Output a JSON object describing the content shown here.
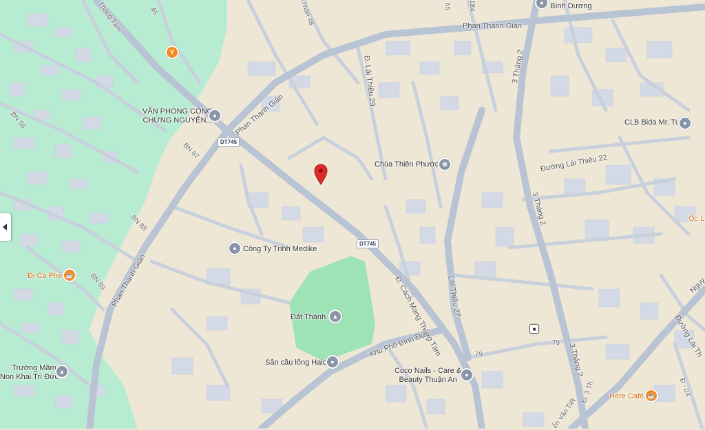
{
  "map": {
    "land_color": "#efe7d6",
    "park_color": "#b8ecd2",
    "road_color": "#b8c3d4",
    "block_color": "#d3dae6",
    "pin_color": "#e02a2a"
  },
  "roads": {
    "phan_thanh_gian_top": "Phan Thanh Gián",
    "phan_thanh_gian_mid": "Phan Thanh Gián",
    "phan_thanh_gian_left": "Phan Thanh Gián",
    "lai_thieu_29": "Đ. Lái Thiêu 29",
    "cmt8": "Đ. Cách Mạng Tháng Tám",
    "three_thang_2_a": "3 Tháng 2",
    "three_thang_2_b": "3 Tháng 2",
    "three_thang_2_c": "3 Tháng 2",
    "lai_thieu_22": "Đường Lái Thiêu 22",
    "lai_thieu_27": "Lái Thiêu 27",
    "khu_pho_binh_duc": "Khu Phố Bình Đức",
    "bn88": "BN 88",
    "bn88b": "BN 88",
    "bn87": "BN 87",
    "bn89": "BN 89",
    "thang_tam": "Tháng Tám",
    "than_48": "Thân 48",
    "n46": "46",
    "n184": "184",
    "n65": "65",
    "n79a": "79",
    "n79b": "79",
    "d04": "Đ - 04",
    "dl3": "Đ. 3 Th",
    "van_viet": "ễn Văn Tiết",
    "lai_thieu_right": "Đường Lái Th",
    "nguy": "Nguy"
  },
  "route_badges": [
    "DT745",
    "DT745"
  ],
  "places": {
    "binh_duong": "Bình Dương",
    "van_phong_line1": "VĂN PHÒNG CÔNG",
    "van_phong_line2": "CHỨNG NGUYỄN...",
    "clb_bida": "CLB Bida Mr. Tui",
    "chua_thien_phuoc": "Chùa Thiên Phước",
    "medike": "Công Ty Tnhh Medike",
    "oc": "Ốc Li",
    "di_ca_phe": "Đi Cà Phê",
    "dat_thanh": "Đất Thánh",
    "san_cau_long": "Sân cầu lông Halo",
    "coco_line1": "Coco Nails - Care &",
    "coco_line2": "Beauty Thuận An",
    "truong_mam_line1": "Trường Mầm",
    "truong_mam_line2": "Non Khai Trí Đức",
    "here_cafe": "Here Café"
  },
  "icons": {
    "pin": "location-pin-icon",
    "place": "place-icon",
    "food": "restaurant-icon",
    "cafe": "coffee-cup-icon",
    "temple": "temple-icon",
    "school": "school-icon",
    "bus": "bus-stop-icon",
    "collapse": "chevron-left-icon"
  }
}
